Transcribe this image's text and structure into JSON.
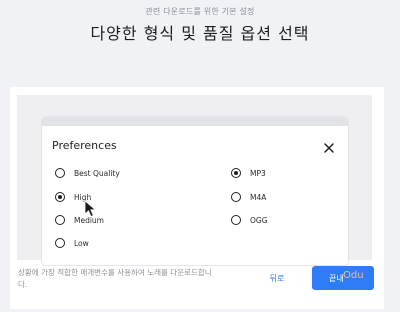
{
  "header": {
    "subtitle": "관련 다운로드를 위한 기본 설정",
    "title": "다양한 형식 및 품질 옵션 선택"
  },
  "dialog": {
    "title": "Preferences",
    "close_icon": "close-icon",
    "quality_options": [
      {
        "label": "Best Quality",
        "checked": false
      },
      {
        "label": "High",
        "checked": true
      },
      {
        "label": "Medium",
        "checked": false
      },
      {
        "label": "Low",
        "checked": false
      }
    ],
    "format_options": [
      {
        "label": "MP3",
        "checked": true
      },
      {
        "label": "M4A",
        "checked": false
      },
      {
        "label": "OGG",
        "checked": false
      }
    ]
  },
  "footer": {
    "description": "상황에 가장 적합한 매개변수를 사용하여 노래를 다운로드합니다.",
    "back_label": "뒤로",
    "next_label": "끝내",
    "watermark": "Odu"
  },
  "colors": {
    "accent": "#2f7df6",
    "background": "#f1f2f5"
  }
}
